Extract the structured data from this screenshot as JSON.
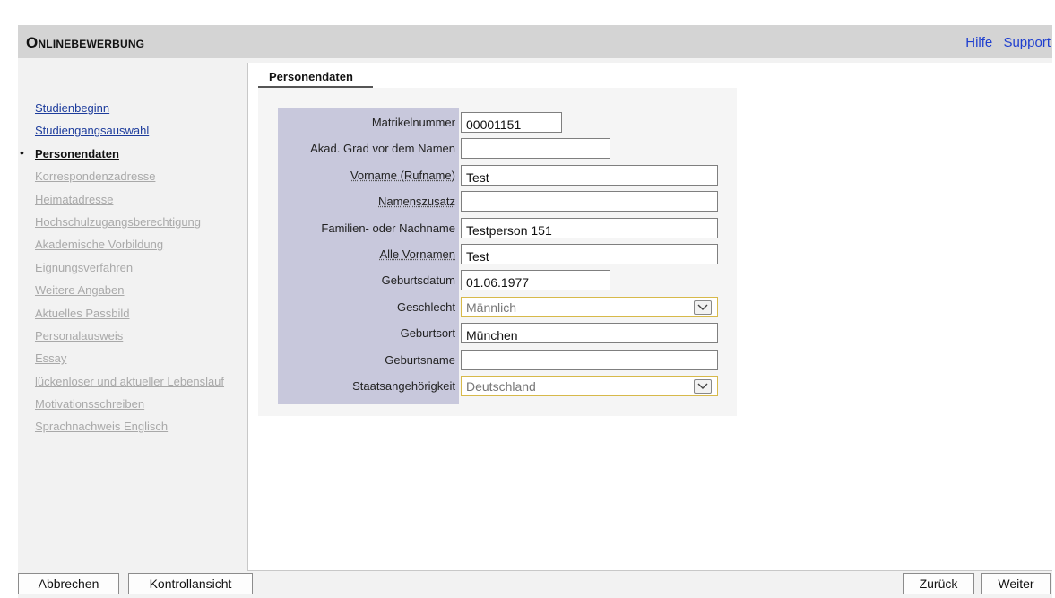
{
  "header": {
    "title": "Onlinebewerbung",
    "links": [
      "Hilfe",
      "Support"
    ]
  },
  "sidebar": {
    "items": [
      {
        "label": "Studienbeginn",
        "state": "done"
      },
      {
        "label": "Studiengangsauswahl",
        "state": "done"
      },
      {
        "label": "Personendaten",
        "state": "active"
      },
      {
        "label": "Korrespondenzadresse",
        "state": "disabled"
      },
      {
        "label": "Heimatadresse",
        "state": "disabled"
      },
      {
        "label": "Hochschulzugangsberechtigung",
        "state": "disabled"
      },
      {
        "label": "Akademische Vorbildung",
        "state": "disabled"
      },
      {
        "label": "Eignungsverfahren",
        "state": "disabled"
      },
      {
        "label": "Weitere Angaben",
        "state": "disabled"
      },
      {
        "label": "Aktuelles Passbild",
        "state": "disabled"
      },
      {
        "label": "Personalausweis",
        "state": "disabled"
      },
      {
        "label": "Essay",
        "state": "disabled"
      },
      {
        "label": "lückenloser und aktueller Lebenslauf",
        "state": "disabled"
      },
      {
        "label": "Motivationsschreiben",
        "state": "disabled"
      },
      {
        "label": "Sprachnachweis Englisch",
        "state": "disabled"
      }
    ]
  },
  "content": {
    "section_title": "Personendaten",
    "fields": [
      {
        "label": "Matrikelnummer",
        "value": "00001151",
        "type": "text",
        "help": false
      },
      {
        "label": "Akad. Grad vor dem Namen",
        "value": "",
        "type": "text",
        "help": false
      },
      {
        "label": "Vorname (Rufname)",
        "value": "Test",
        "type": "text",
        "help": true
      },
      {
        "label": "Namenszusatz",
        "value": "",
        "type": "text",
        "help": true
      },
      {
        "label": "Familien- oder Nachname",
        "value": "Testperson 151",
        "type": "text",
        "help": false
      },
      {
        "label": "Alle Vornamen",
        "value": "Test",
        "type": "text",
        "help": true
      },
      {
        "label": "Geburtsdatum",
        "value": "01.06.1977",
        "type": "text",
        "help": false
      },
      {
        "label": "Geschlecht",
        "value": "Männlich",
        "type": "select",
        "help": false
      },
      {
        "label": "Geburtsort",
        "value": "München",
        "type": "text",
        "help": false
      },
      {
        "label": "Geburtsname",
        "value": "",
        "type": "text",
        "help": false
      },
      {
        "label": "Staatsangehörigkeit",
        "value": "Deutschland",
        "type": "select",
        "help": false
      }
    ]
  },
  "footer": {
    "cancel_label": "Abbrechen",
    "review_label": "Kontrollansicht",
    "back_label": "Zurück",
    "next_label": "Weiter"
  },
  "colors": {
    "header_bg": "#d4d4d4",
    "label_column_bg": "#c8c8dc",
    "link_blue": "#1d3c9c",
    "select_border": "#d7b94a"
  }
}
